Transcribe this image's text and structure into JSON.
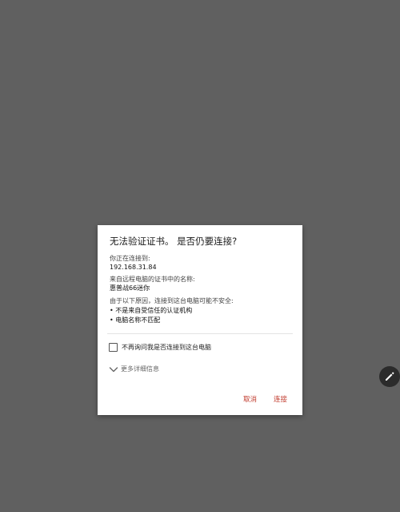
{
  "dialog": {
    "title": "无法验证证书。 是否仍要连接?",
    "connecting_label": "你正在连接到:",
    "host": "192.168.31.84",
    "cert_name_label": "来自远程电脑的证书中的名称:",
    "cert_name": "惠普战66迷你",
    "reason_label": "由于以下原因，连接到这台电脑可能不安全:",
    "reasons": [
      "• 不是来自受信任的认证机构",
      "• 电脑名称不匹配"
    ],
    "checkbox_label": "不再询问我是否连接到这台电脑",
    "more_details": "更多详细信息",
    "cancel_label": "取消",
    "connect_label": "连接"
  },
  "icons": {
    "checkbox": "checkbox-unchecked-icon",
    "chevron": "chevron-down-icon",
    "fab": "pencil-icon"
  },
  "colors": {
    "background": "#606060",
    "dialog": "#ffffff",
    "accent": "#c0392b",
    "fab": "#2b2b2b"
  }
}
